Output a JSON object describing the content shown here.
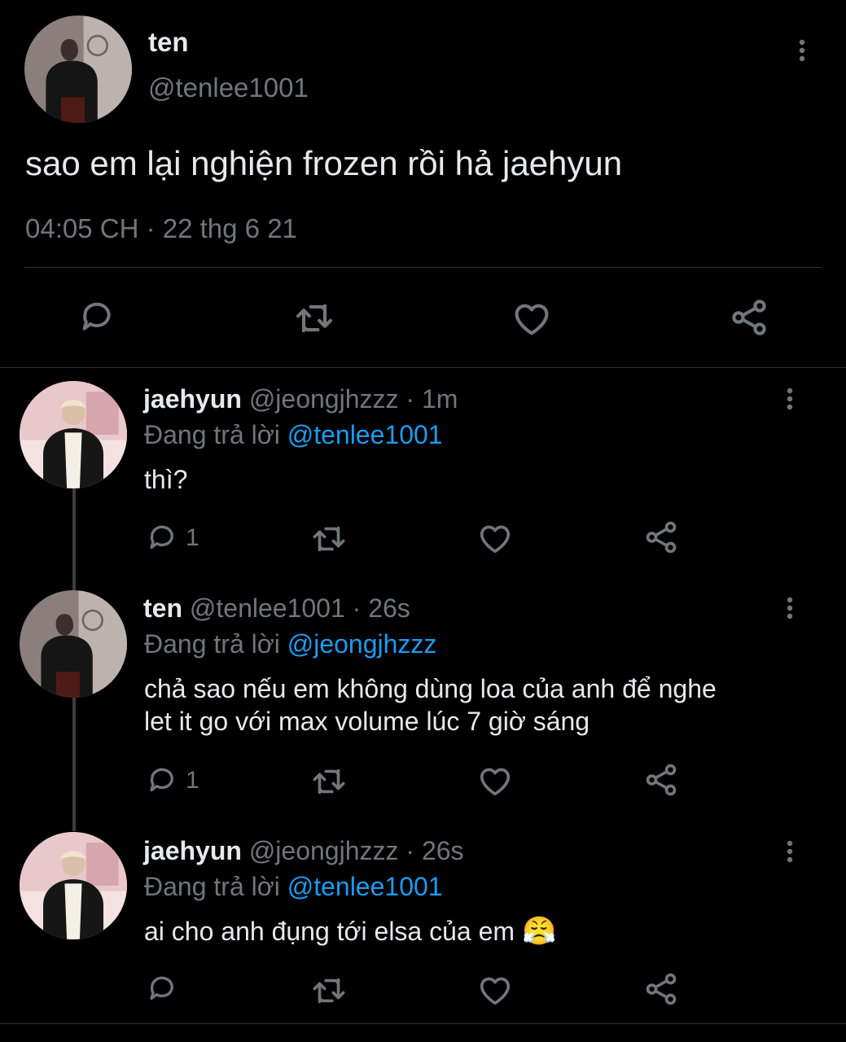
{
  "main_tweet": {
    "display_name": "ten",
    "handle": "@tenlee1001",
    "text": "sao em lại nghiện frozen rồi hả jaehyun",
    "time": "04:05 CH",
    "separator": "·",
    "date": "22 thg 6 21"
  },
  "replies": [
    {
      "display_name": "jaehyun",
      "handle": "@jeongjhzzz",
      "age": "1m",
      "replying_prefix": "Đang trả lời",
      "replying_to": "@tenlee1001",
      "text": "thì?",
      "reply_count": "1",
      "emoji": ""
    },
    {
      "display_name": "ten",
      "handle": "@tenlee1001",
      "age": "26s",
      "replying_prefix": "Đang trả lời",
      "replying_to": "@jeongjhzzz",
      "text_line1": "chả sao nếu em không dùng loa của anh để nghe",
      "text_line2": "let it go với max volume lúc 7 giờ sáng",
      "reply_count": "1"
    },
    {
      "display_name": "jaehyun",
      "handle": "@jeongjhzzz",
      "age": "26s",
      "replying_prefix": "Đang trả lời",
      "replying_to": "@tenlee1001",
      "text": "ai cho anh đụng tới elsa của em",
      "emoji": "😤",
      "reply_count": ""
    }
  ],
  "dot": "·",
  "icons": [
    "reply-icon",
    "retweet-icon",
    "like-icon",
    "share-icon",
    "more-icon"
  ],
  "colors": {
    "background": "#000000",
    "text": "#e7e9ea",
    "muted": "#71767b",
    "link": "#1d9bf0",
    "divider": "#2f3336"
  }
}
